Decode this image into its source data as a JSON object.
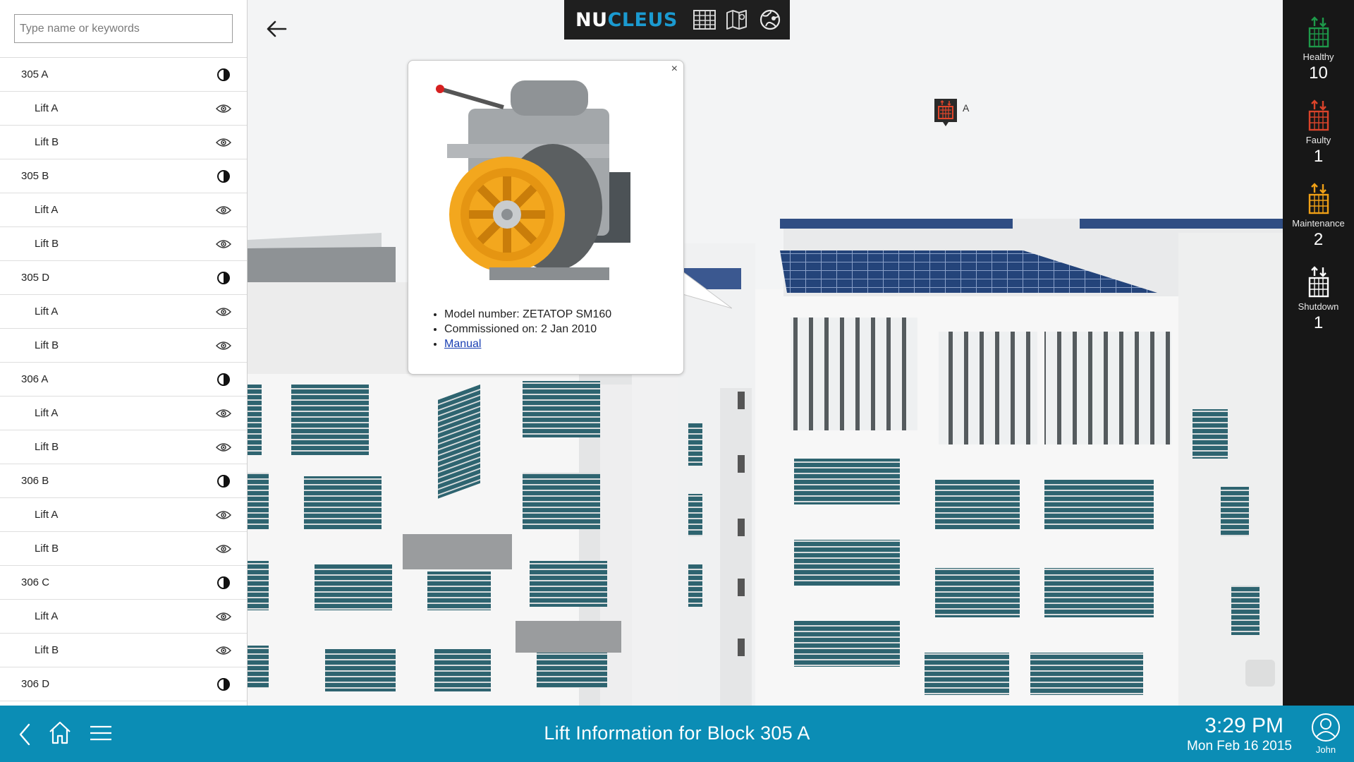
{
  "search": {
    "placeholder": "Type name or keywords"
  },
  "tree": [
    {
      "label": "305 A",
      "type": "block"
    },
    {
      "label": "Lift A",
      "type": "lift"
    },
    {
      "label": "Lift B",
      "type": "lift"
    },
    {
      "label": "305 B",
      "type": "block"
    },
    {
      "label": "Lift A",
      "type": "lift"
    },
    {
      "label": "Lift B",
      "type": "lift"
    },
    {
      "label": "305 D",
      "type": "block"
    },
    {
      "label": "Lift A",
      "type": "lift"
    },
    {
      "label": "Lift B",
      "type": "lift"
    },
    {
      "label": "306 A",
      "type": "block"
    },
    {
      "label": "Lift A",
      "type": "lift"
    },
    {
      "label": "Lift B",
      "type": "lift"
    },
    {
      "label": "306 B",
      "type": "block"
    },
    {
      "label": "Lift A",
      "type": "lift"
    },
    {
      "label": "Lift B",
      "type": "lift"
    },
    {
      "label": "306 C",
      "type": "block"
    },
    {
      "label": "Lift A",
      "type": "lift"
    },
    {
      "label": "Lift B",
      "type": "lift"
    },
    {
      "label": "306 D",
      "type": "block"
    }
  ],
  "logo": {
    "part1": "NU",
    "part2": "CLEUS"
  },
  "views": [
    "grid-icon",
    "map-icon",
    "globe-icon"
  ],
  "popup": {
    "close": "×",
    "model": "Model number: ZETATOP SM160",
    "commissioned": "Commissioned on: 2 Jan 2010",
    "manual": "Manual"
  },
  "marker": {
    "label": "A"
  },
  "status": {
    "healthy": {
      "label": "Healthy",
      "count": "10",
      "color": "#1e9a4a"
    },
    "faulty": {
      "label": "Faulty",
      "count": "1",
      "color": "#d9432a"
    },
    "maintenance": {
      "label": "Maintenance",
      "count": "2",
      "color": "#f0a016"
    },
    "shutdown": {
      "label": "Shutdown",
      "count": "1",
      "color": "#ffffff"
    }
  },
  "footer": {
    "title": "Lift Information for Block 305 A",
    "time": "3:29 PM",
    "date": "Mon Feb 16 2015",
    "user": "John"
  },
  "colors": {
    "accent": "#0b8db5",
    "logo_blue": "#1b9ad0"
  }
}
